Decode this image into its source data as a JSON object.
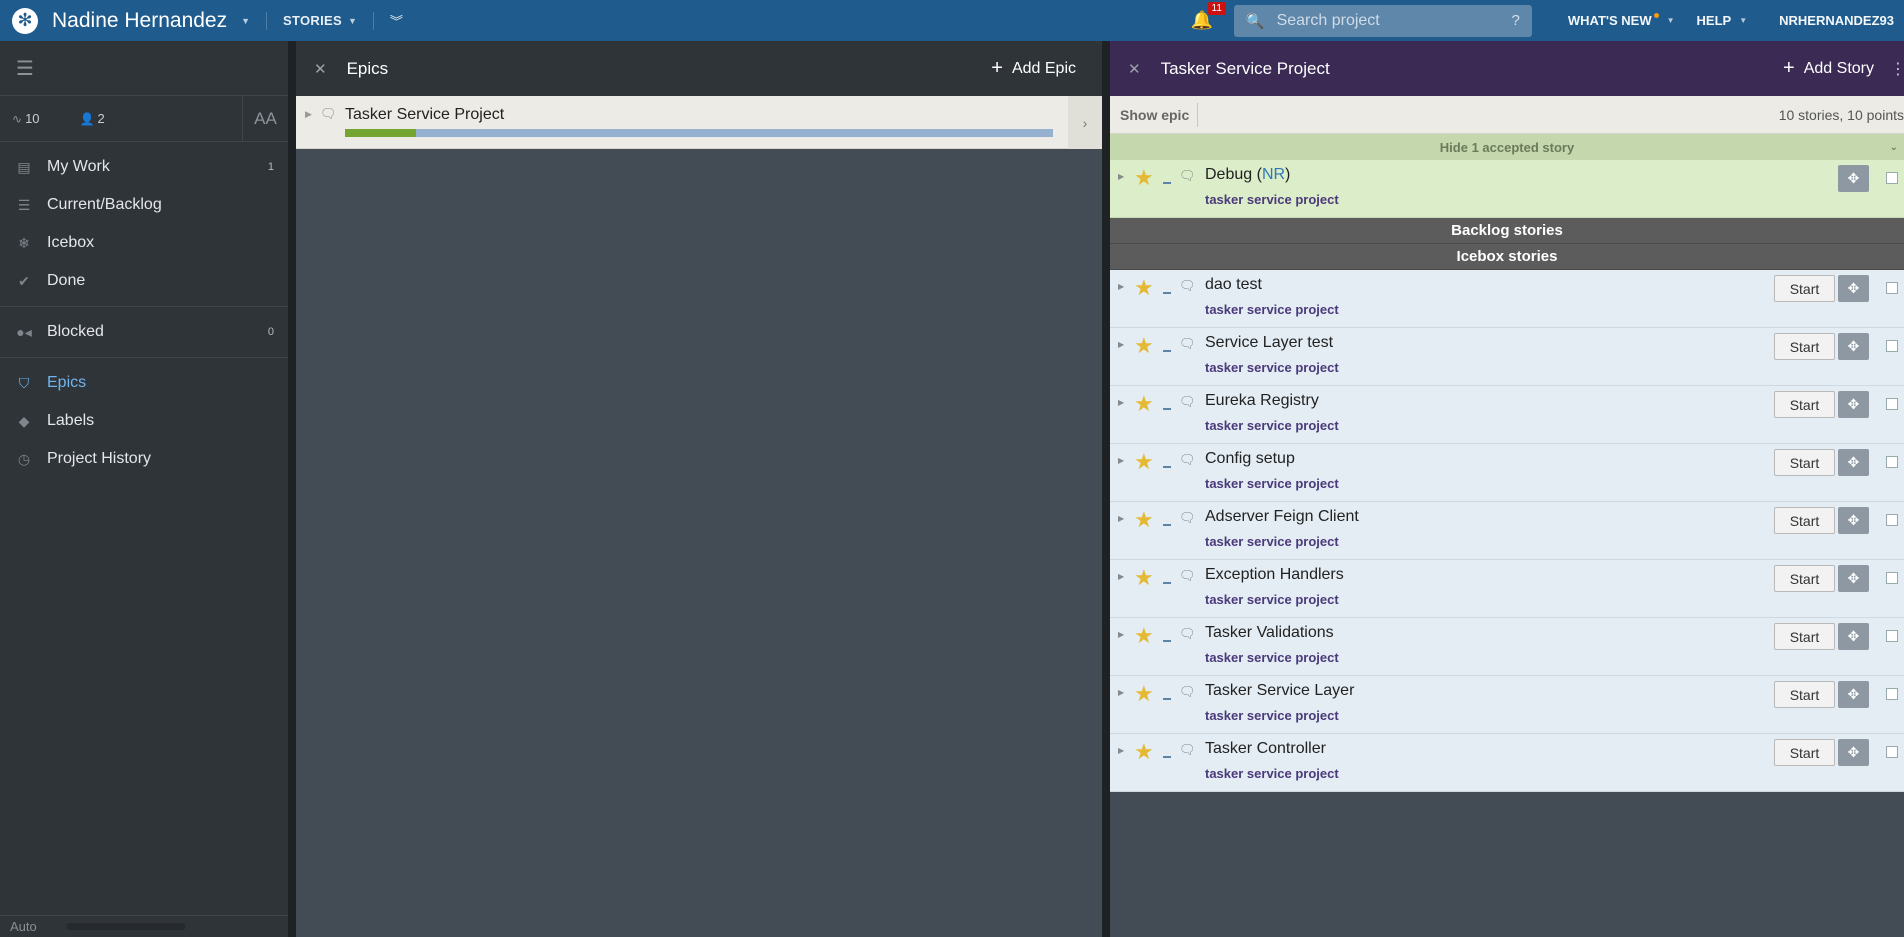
{
  "topbar": {
    "project_name": "Nadine Hernandez",
    "stories_menu": "STORIES",
    "notifications_count": "11",
    "search_placeholder": "Search project",
    "search_help": "?",
    "whats_new": "WHAT'S NEW",
    "help": "HELP",
    "username": "NRHERNANDEZ93"
  },
  "sidebar": {
    "stats": {
      "velocity": "10",
      "members": "2"
    },
    "text_size": "AA",
    "items": [
      {
        "label": "My Work",
        "count": "1",
        "icon": "inbox-icon"
      },
      {
        "label": "Current/Backlog",
        "count": "",
        "icon": "list-icon"
      },
      {
        "label": "Icebox",
        "count": "",
        "icon": "snowflake-icon"
      },
      {
        "label": "Done",
        "count": "",
        "icon": "check-icon"
      },
      {
        "label": "Blocked",
        "count": "0",
        "icon": "blocked-icon"
      },
      {
        "label": "Epics",
        "count": "",
        "icon": "epic-shield-icon"
      },
      {
        "label": "Labels",
        "count": "",
        "icon": "tag-icon"
      },
      {
        "label": "Project History",
        "count": "",
        "icon": "clock-icon"
      }
    ],
    "footer_mode": "Auto"
  },
  "epics_panel": {
    "title": "Epics",
    "add_label": "Add Epic",
    "epics": [
      {
        "name": "Tasker Service Project",
        "progress": 0.1
      }
    ]
  },
  "stories_panel": {
    "title": "Tasker Service Project",
    "add_label": "Add Story",
    "show_epic": "Show epic",
    "count_text": "10 stories, 10 points",
    "hide_accepted": "Hide 1 accepted story",
    "backlog_header": "Backlog stories",
    "icebox_header": "Icebox stories",
    "accepted_story": {
      "name": "Debug",
      "owner": "NR",
      "label": "tasker service project"
    },
    "start_label": "Start",
    "icebox_stories": [
      {
        "name": "dao test",
        "label": "tasker service project"
      },
      {
        "name": "Service Layer test",
        "label": "tasker service project"
      },
      {
        "name": "Eureka Registry",
        "label": "tasker service project"
      },
      {
        "name": "Config setup",
        "label": "tasker service project"
      },
      {
        "name": "Adserver Feign Client",
        "label": "tasker service project"
      },
      {
        "name": "Exception Handlers",
        "label": "tasker service project"
      },
      {
        "name": "Tasker Validations",
        "label": "tasker service project"
      },
      {
        "name": "Tasker Service Layer",
        "label": "tasker service project"
      },
      {
        "name": "Tasker Controller",
        "label": "tasker service project"
      }
    ]
  },
  "colors": {
    "topbar": "#1f5b8c",
    "story_panel_header": "#3a2a54",
    "accepted_bg": "#dcedc9",
    "icebox_bg": "#e4edf4",
    "star": "#e4b935"
  }
}
